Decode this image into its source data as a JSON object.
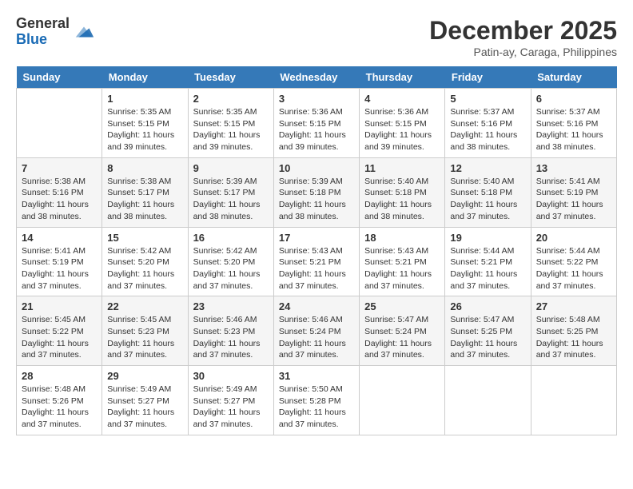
{
  "header": {
    "logo_general": "General",
    "logo_blue": "Blue",
    "month": "December 2025",
    "location": "Patin-ay, Caraga, Philippines"
  },
  "days_of_week": [
    "Sunday",
    "Monday",
    "Tuesday",
    "Wednesday",
    "Thursday",
    "Friday",
    "Saturday"
  ],
  "weeks": [
    [
      {
        "day": "",
        "sunrise": "",
        "sunset": "",
        "daylight": ""
      },
      {
        "day": "1",
        "sunrise": "Sunrise: 5:35 AM",
        "sunset": "Sunset: 5:15 PM",
        "daylight": "Daylight: 11 hours and 39 minutes."
      },
      {
        "day": "2",
        "sunrise": "Sunrise: 5:35 AM",
        "sunset": "Sunset: 5:15 PM",
        "daylight": "Daylight: 11 hours and 39 minutes."
      },
      {
        "day": "3",
        "sunrise": "Sunrise: 5:36 AM",
        "sunset": "Sunset: 5:15 PM",
        "daylight": "Daylight: 11 hours and 39 minutes."
      },
      {
        "day": "4",
        "sunrise": "Sunrise: 5:36 AM",
        "sunset": "Sunset: 5:15 PM",
        "daylight": "Daylight: 11 hours and 39 minutes."
      },
      {
        "day": "5",
        "sunrise": "Sunrise: 5:37 AM",
        "sunset": "Sunset: 5:16 PM",
        "daylight": "Daylight: 11 hours and 38 minutes."
      },
      {
        "day": "6",
        "sunrise": "Sunrise: 5:37 AM",
        "sunset": "Sunset: 5:16 PM",
        "daylight": "Daylight: 11 hours and 38 minutes."
      }
    ],
    [
      {
        "day": "7",
        "sunrise": "Sunrise: 5:38 AM",
        "sunset": "Sunset: 5:16 PM",
        "daylight": "Daylight: 11 hours and 38 minutes."
      },
      {
        "day": "8",
        "sunrise": "Sunrise: 5:38 AM",
        "sunset": "Sunset: 5:17 PM",
        "daylight": "Daylight: 11 hours and 38 minutes."
      },
      {
        "day": "9",
        "sunrise": "Sunrise: 5:39 AM",
        "sunset": "Sunset: 5:17 PM",
        "daylight": "Daylight: 11 hours and 38 minutes."
      },
      {
        "day": "10",
        "sunrise": "Sunrise: 5:39 AM",
        "sunset": "Sunset: 5:18 PM",
        "daylight": "Daylight: 11 hours and 38 minutes."
      },
      {
        "day": "11",
        "sunrise": "Sunrise: 5:40 AM",
        "sunset": "Sunset: 5:18 PM",
        "daylight": "Daylight: 11 hours and 38 minutes."
      },
      {
        "day": "12",
        "sunrise": "Sunrise: 5:40 AM",
        "sunset": "Sunset: 5:18 PM",
        "daylight": "Daylight: 11 hours and 37 minutes."
      },
      {
        "day": "13",
        "sunrise": "Sunrise: 5:41 AM",
        "sunset": "Sunset: 5:19 PM",
        "daylight": "Daylight: 11 hours and 37 minutes."
      }
    ],
    [
      {
        "day": "14",
        "sunrise": "Sunrise: 5:41 AM",
        "sunset": "Sunset: 5:19 PM",
        "daylight": "Daylight: 11 hours and 37 minutes."
      },
      {
        "day": "15",
        "sunrise": "Sunrise: 5:42 AM",
        "sunset": "Sunset: 5:20 PM",
        "daylight": "Daylight: 11 hours and 37 minutes."
      },
      {
        "day": "16",
        "sunrise": "Sunrise: 5:42 AM",
        "sunset": "Sunset: 5:20 PM",
        "daylight": "Daylight: 11 hours and 37 minutes."
      },
      {
        "day": "17",
        "sunrise": "Sunrise: 5:43 AM",
        "sunset": "Sunset: 5:21 PM",
        "daylight": "Daylight: 11 hours and 37 minutes."
      },
      {
        "day": "18",
        "sunrise": "Sunrise: 5:43 AM",
        "sunset": "Sunset: 5:21 PM",
        "daylight": "Daylight: 11 hours and 37 minutes."
      },
      {
        "day": "19",
        "sunrise": "Sunrise: 5:44 AM",
        "sunset": "Sunset: 5:21 PM",
        "daylight": "Daylight: 11 hours and 37 minutes."
      },
      {
        "day": "20",
        "sunrise": "Sunrise: 5:44 AM",
        "sunset": "Sunset: 5:22 PM",
        "daylight": "Daylight: 11 hours and 37 minutes."
      }
    ],
    [
      {
        "day": "21",
        "sunrise": "Sunrise: 5:45 AM",
        "sunset": "Sunset: 5:22 PM",
        "daylight": "Daylight: 11 hours and 37 minutes."
      },
      {
        "day": "22",
        "sunrise": "Sunrise: 5:45 AM",
        "sunset": "Sunset: 5:23 PM",
        "daylight": "Daylight: 11 hours and 37 minutes."
      },
      {
        "day": "23",
        "sunrise": "Sunrise: 5:46 AM",
        "sunset": "Sunset: 5:23 PM",
        "daylight": "Daylight: 11 hours and 37 minutes."
      },
      {
        "day": "24",
        "sunrise": "Sunrise: 5:46 AM",
        "sunset": "Sunset: 5:24 PM",
        "daylight": "Daylight: 11 hours and 37 minutes."
      },
      {
        "day": "25",
        "sunrise": "Sunrise: 5:47 AM",
        "sunset": "Sunset: 5:24 PM",
        "daylight": "Daylight: 11 hours and 37 minutes."
      },
      {
        "day": "26",
        "sunrise": "Sunrise: 5:47 AM",
        "sunset": "Sunset: 5:25 PM",
        "daylight": "Daylight: 11 hours and 37 minutes."
      },
      {
        "day": "27",
        "sunrise": "Sunrise: 5:48 AM",
        "sunset": "Sunset: 5:25 PM",
        "daylight": "Daylight: 11 hours and 37 minutes."
      }
    ],
    [
      {
        "day": "28",
        "sunrise": "Sunrise: 5:48 AM",
        "sunset": "Sunset: 5:26 PM",
        "daylight": "Daylight: 11 hours and 37 minutes."
      },
      {
        "day": "29",
        "sunrise": "Sunrise: 5:49 AM",
        "sunset": "Sunset: 5:27 PM",
        "daylight": "Daylight: 11 hours and 37 minutes."
      },
      {
        "day": "30",
        "sunrise": "Sunrise: 5:49 AM",
        "sunset": "Sunset: 5:27 PM",
        "daylight": "Daylight: 11 hours and 37 minutes."
      },
      {
        "day": "31",
        "sunrise": "Sunrise: 5:50 AM",
        "sunset": "Sunset: 5:28 PM",
        "daylight": "Daylight: 11 hours and 37 minutes."
      },
      {
        "day": "",
        "sunrise": "",
        "sunset": "",
        "daylight": ""
      },
      {
        "day": "",
        "sunrise": "",
        "sunset": "",
        "daylight": ""
      },
      {
        "day": "",
        "sunrise": "",
        "sunset": "",
        "daylight": ""
      }
    ]
  ]
}
